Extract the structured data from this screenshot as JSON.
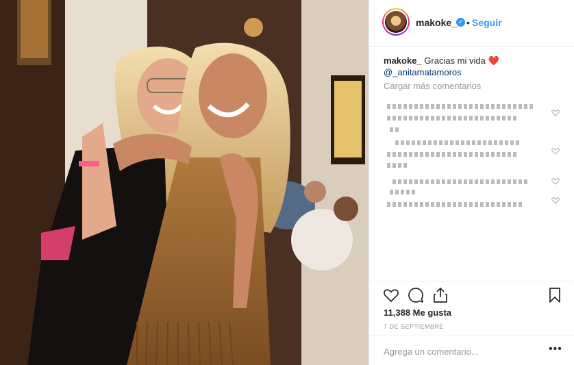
{
  "post": {
    "username": "makoke_",
    "verified_icon": "verified-badge-icon",
    "separator": "•",
    "follow_label": "Seguir",
    "photo_icon": "post-photo"
  },
  "caption": {
    "username": "makoke_",
    "text": "Gracias mi vida",
    "emoji": "❤️",
    "mention": "@_anitamatamoros"
  },
  "comments": {
    "load_more_label": "Cargar más comentarios",
    "pixelated_note": ""
  },
  "actions": {
    "like_icon": "heart-icon",
    "comment_icon": "comment-icon",
    "share_icon": "share-icon",
    "save_icon": "bookmark-icon"
  },
  "likes": {
    "text": "11,388 Me gusta"
  },
  "date": {
    "text": "7 DE SEPTIEMBRE"
  },
  "add_comment": {
    "placeholder": "Agrega un comentario..."
  },
  "more_icon": "more-options-icon",
  "colors": {
    "link": "#3897f0",
    "mention": "#003569",
    "heart": "#e0245e"
  }
}
